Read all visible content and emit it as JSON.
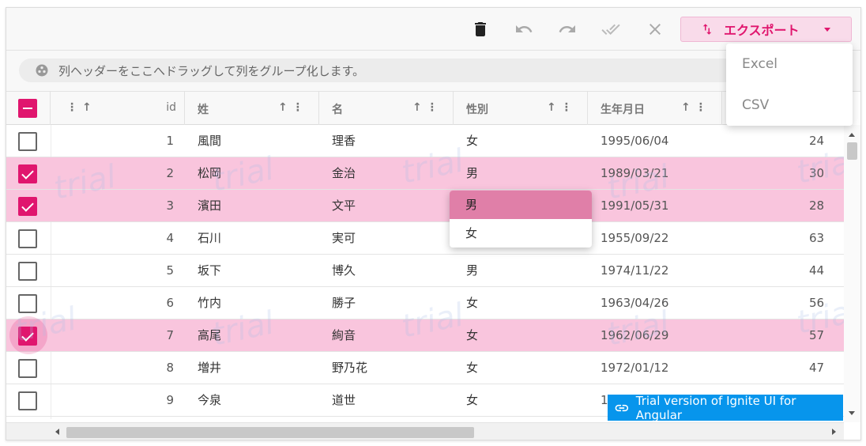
{
  "toolbar": {
    "delete_icon": "trash-icon",
    "undo_icon": "undo-icon",
    "redo_icon": "redo-icon",
    "commit_icon": "done-all-icon",
    "discard_icon": "close-icon",
    "export_label": "エクスポート"
  },
  "export_menu": {
    "items": [
      "Excel",
      "CSV"
    ]
  },
  "group_area": {
    "text": "列ヘッダーをここへドラッグして列をグループ化します。"
  },
  "columns": {
    "id": "id",
    "sei": "姓",
    "mei": "名",
    "sex": "性別",
    "dob": "生年月日"
  },
  "rows": [
    {
      "selected": false,
      "id": "1",
      "sei": "風間",
      "mei": "理香",
      "sex": "女",
      "dob": "1995/06/04",
      "more": "24"
    },
    {
      "selected": true,
      "id": "2",
      "sei": "松岡",
      "mei": "金治",
      "sex": "男",
      "dob": "1989/03/21",
      "more": "30"
    },
    {
      "selected": true,
      "id": "3",
      "sei": "濱田",
      "mei": "文平",
      "sex": "",
      "dob": "1991/05/31",
      "more": "28"
    },
    {
      "selected": false,
      "id": "4",
      "sei": "石川",
      "mei": "実可",
      "sex": "",
      "dob": "1955/09/22",
      "more": "63"
    },
    {
      "selected": false,
      "id": "5",
      "sei": "坂下",
      "mei": "博久",
      "sex": "男",
      "dob": "1974/11/22",
      "more": "44"
    },
    {
      "selected": false,
      "id": "6",
      "sei": "竹内",
      "mei": "勝子",
      "sex": "女",
      "dob": "1963/04/26",
      "more": "56"
    },
    {
      "selected": true,
      "id": "7",
      "sei": "高尾",
      "mei": "絢音",
      "sex": "女",
      "dob": "1962/06/29",
      "more": "57"
    },
    {
      "selected": false,
      "id": "8",
      "sei": "増井",
      "mei": "野乃花",
      "sex": "女",
      "dob": "1972/01/12",
      "more": "47"
    },
    {
      "selected": false,
      "id": "9",
      "sei": "今泉",
      "mei": "道世",
      "sex": "女",
      "dob": "1",
      "more": ""
    }
  ],
  "sex_dropdown": {
    "options": [
      "男",
      "女"
    ],
    "active": "男"
  },
  "trial_banner": "Trial version of Ignite UI for Angular",
  "watermark_text": "trial",
  "colors": {
    "accent": "#e0166e",
    "selected_row": "#f9c5dd",
    "banner": "#0795ec"
  }
}
